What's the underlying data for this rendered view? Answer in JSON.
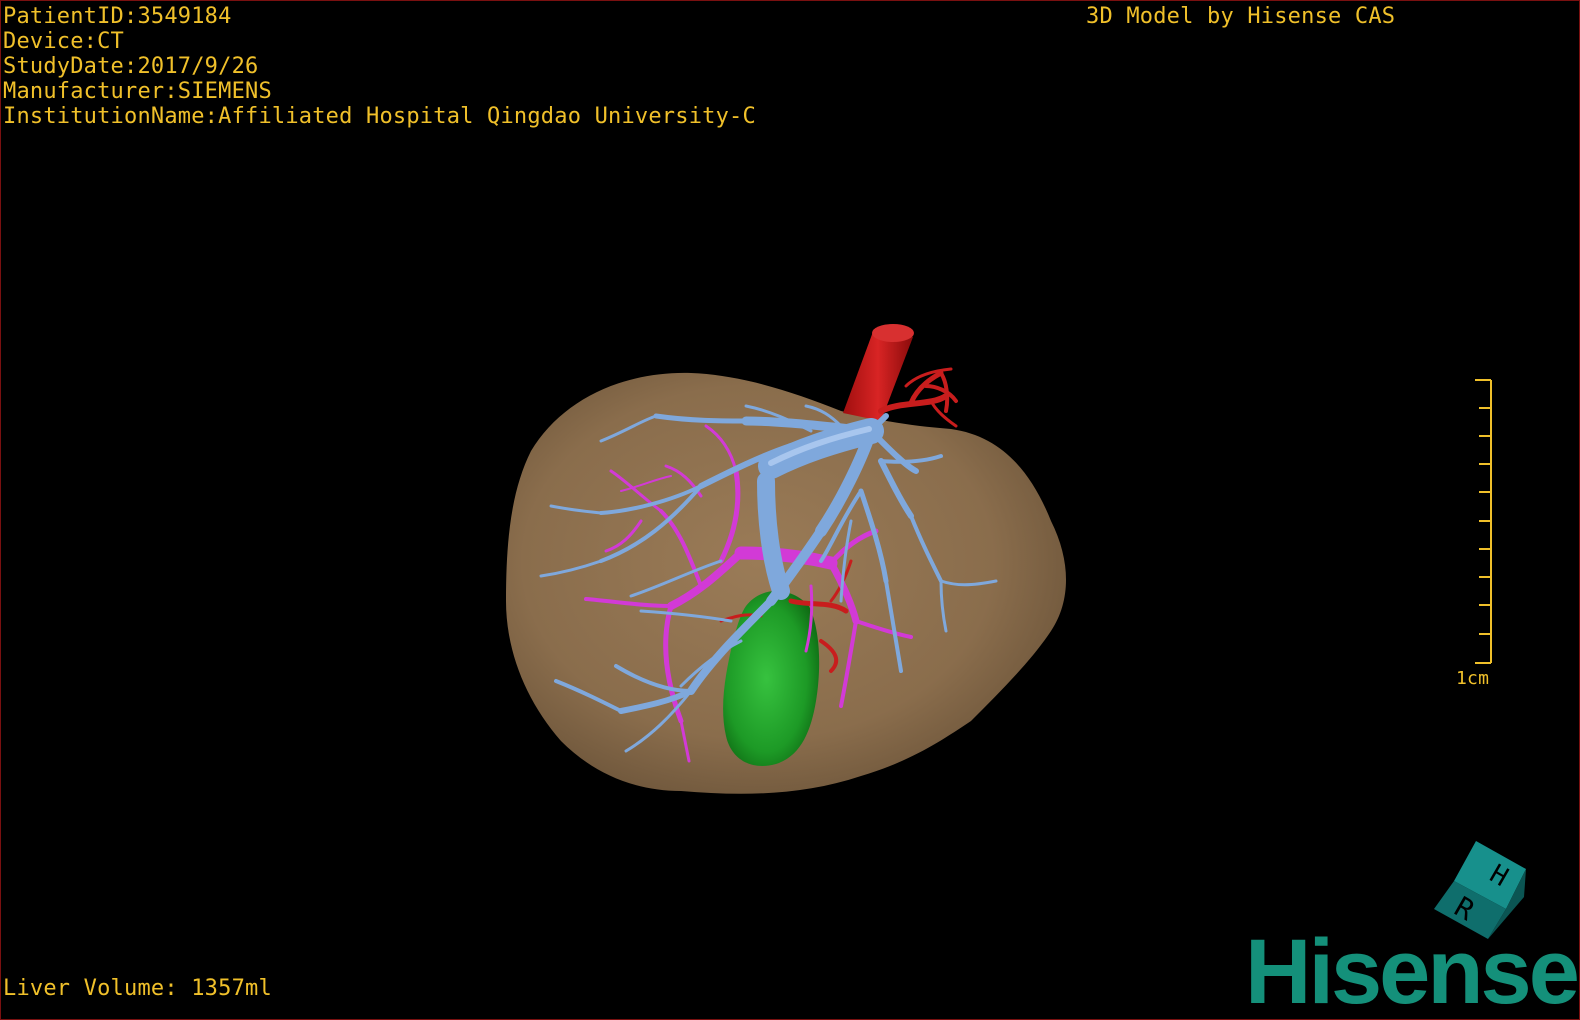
{
  "info": {
    "patient_id": "PatientID:3549184",
    "device": "Device:CT",
    "study_date": "StudyDate:2017/9/26",
    "manufacturer": "Manufacturer:SIEMENS",
    "institution": "InstitutionName:Affiliated Hospital Qingdao University-C"
  },
  "credit": "3D Model by Hisense CAS",
  "footer": {
    "liver_volume": "Liver Volume: 1357ml"
  },
  "scale": {
    "label": "1cm"
  },
  "orientation_cube": {
    "labels": [
      "H",
      "R"
    ],
    "color": "#127a78"
  },
  "logo": {
    "text": "Hisense",
    "color": "#14907a"
  },
  "colors": {
    "overlay_text": "#f0c02a",
    "liver": "#8a6d4c",
    "hepatic_vein": "#7fa8dc",
    "portal_vein": "#d23ad6",
    "artery": "#c81d1d",
    "gallbladder": "#1d9a26"
  }
}
